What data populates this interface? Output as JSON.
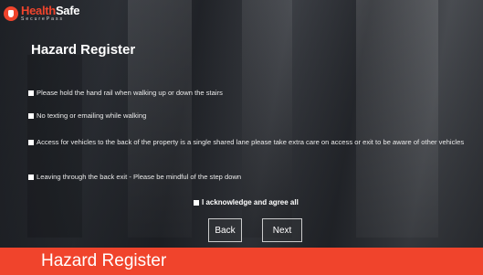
{
  "brand": {
    "name_accent": "Health",
    "name_rest": "Safe",
    "subtitle": "SecurePass"
  },
  "page": {
    "title": "Hazard Register"
  },
  "items": [
    "Please hold the hand rail when walking up or down the stairs",
    "No texting or emailing while walking",
    "Access for vehicles to the back of the property is a single shared lane please take extra care on access or exit to be aware of other vehicles",
    "Leaving through the back exit - Please be mindful of the step down"
  ],
  "acknowledge": {
    "label": "I acknowledge and agree all"
  },
  "buttons": {
    "back": "Back",
    "next": "Next"
  },
  "footer": {
    "title": "Hazard Register"
  },
  "colors": {
    "accent": "#f0442c"
  }
}
